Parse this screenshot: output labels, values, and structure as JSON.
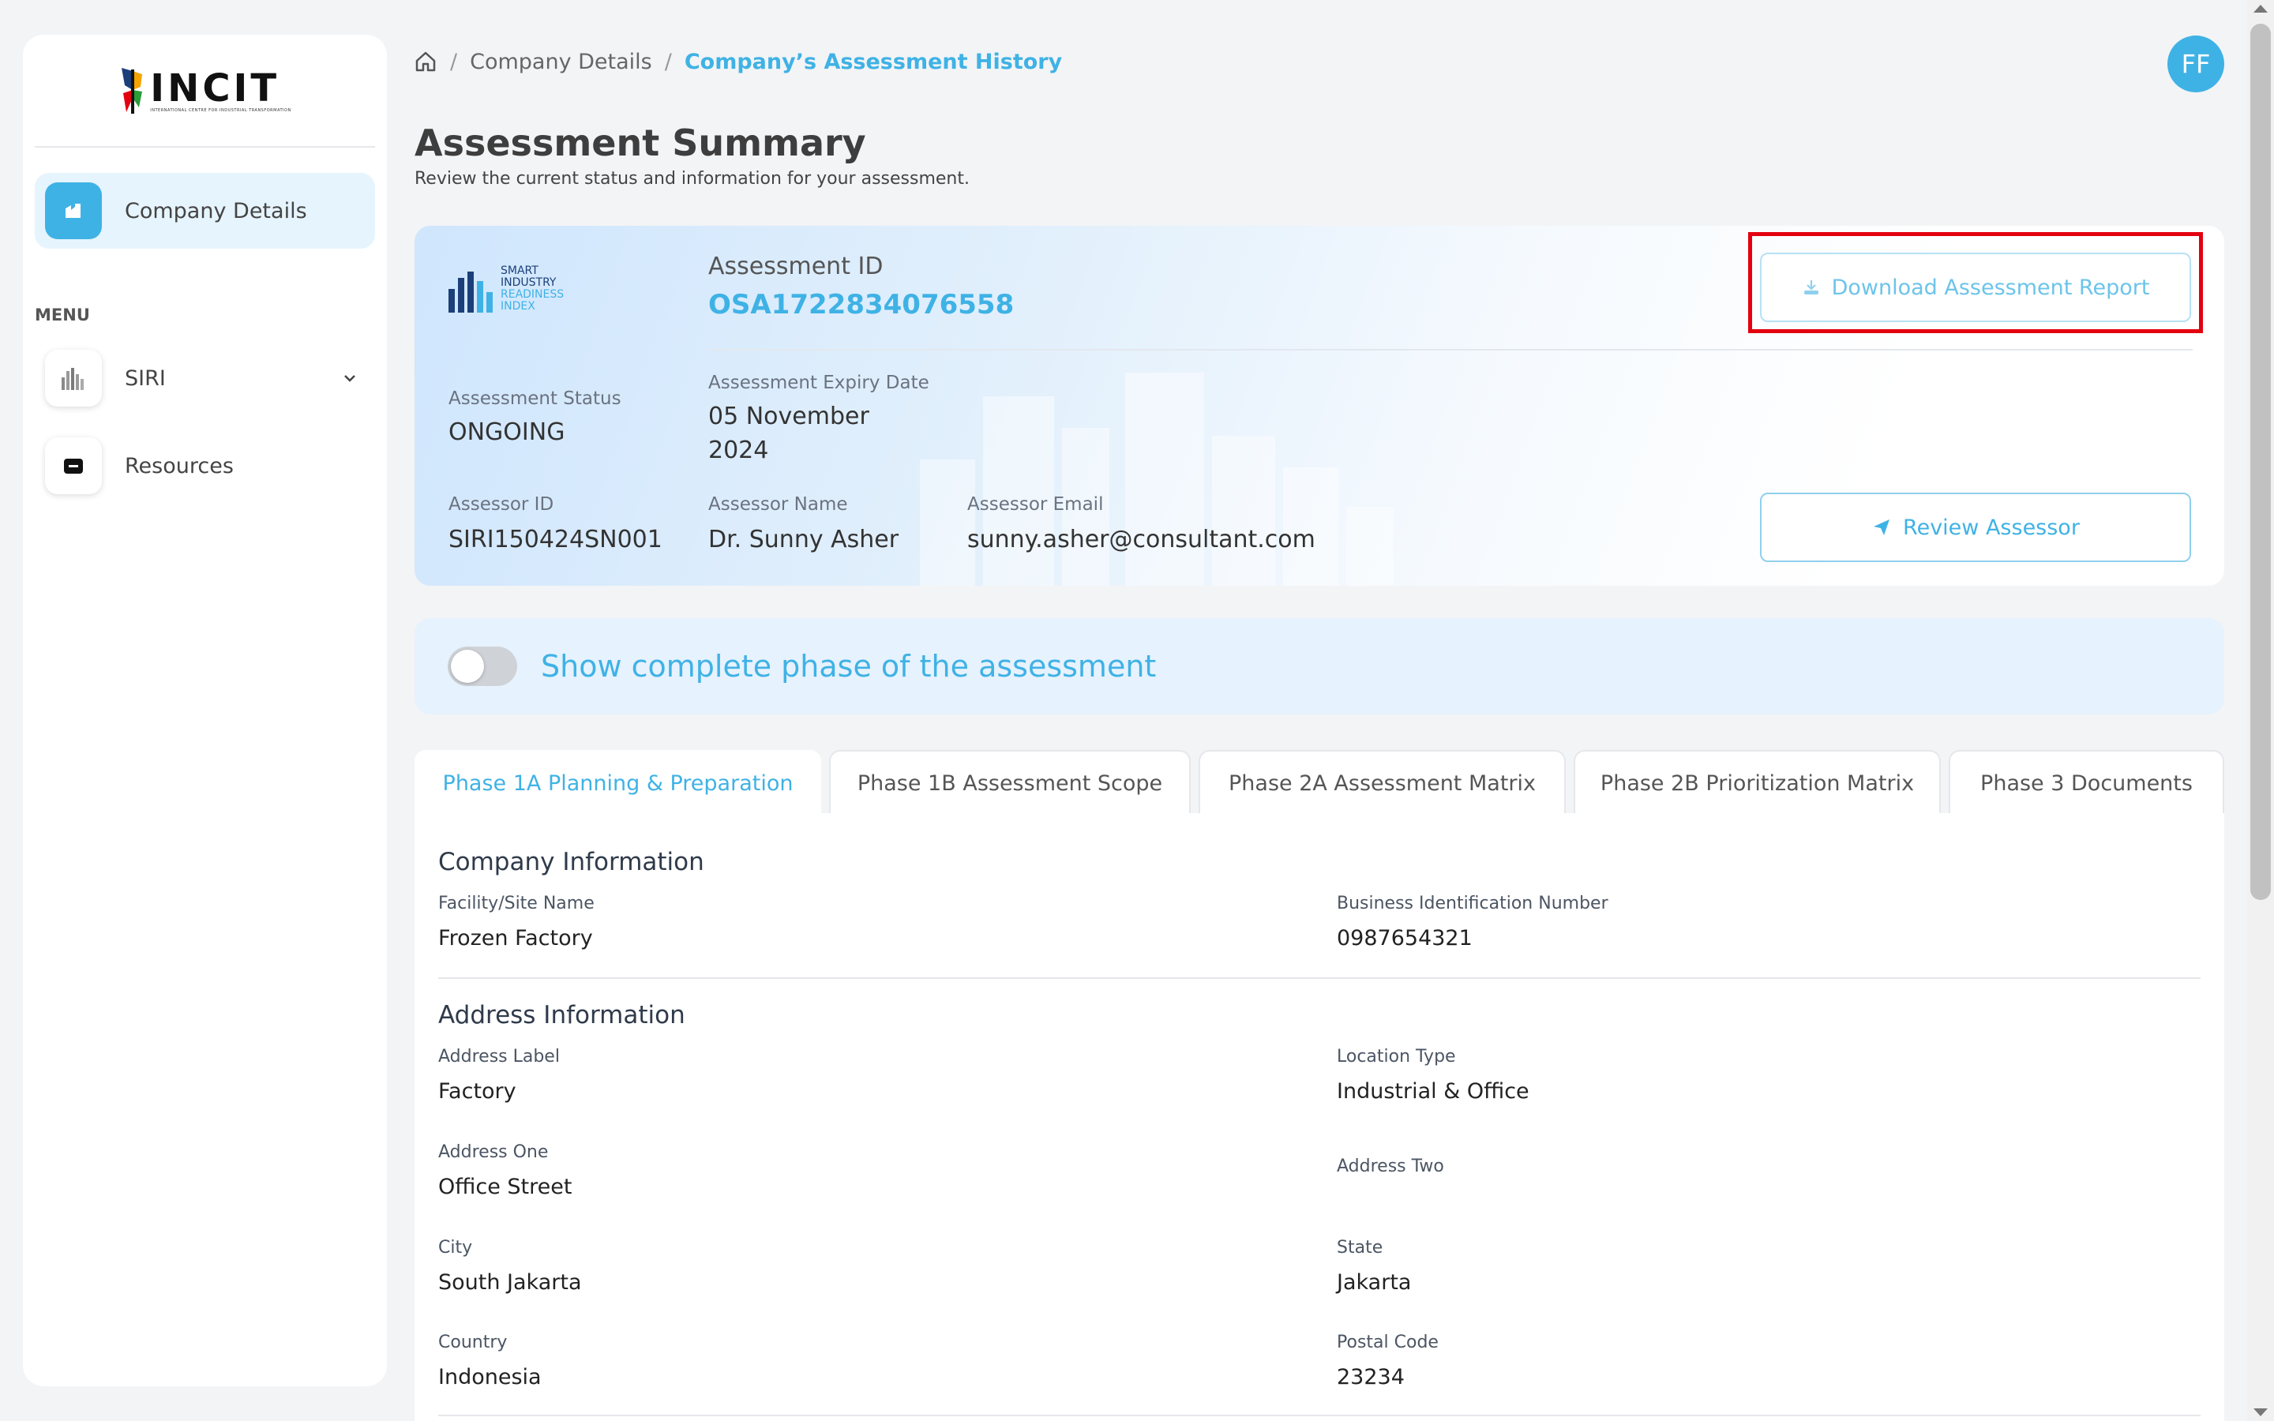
{
  "sidebar": {
    "logo_text": "INCIT",
    "logo_subtext": "INTERNATIONAL CENTRE FOR INDUSTRIAL TRANSFORMATION",
    "active_item": "Company Details",
    "menu_title": "MENU",
    "items": [
      {
        "label": "SIRI",
        "icon": "bar-chart-icon"
      },
      {
        "label": "Resources",
        "icon": "folder-icon"
      }
    ]
  },
  "breadcrumb": {
    "items": [
      "Company Details",
      "Company’s Assessment History"
    ]
  },
  "user": {
    "initials": "FF"
  },
  "page": {
    "title": "Assessment Summary",
    "subtitle": "Review the current status and information for your assessment."
  },
  "summary": {
    "siri_logo": [
      "SMART",
      "INDUSTRY",
      "READINESS",
      "INDEX"
    ],
    "assessment_id_label": "Assessment ID",
    "assessment_id": "OSA1722834076558",
    "download_label": "Download Assessment Report",
    "status_label": "Assessment Status",
    "status": "ONGOING",
    "expiry_label": "Assessment Expiry Date",
    "expiry_line1": "05 November",
    "expiry_line2": "2024",
    "assessor_id_label": "Assessor ID",
    "assessor_id": "SIRI150424SN001",
    "assessor_name_label": "Assessor Name",
    "assessor_name": "Dr. Sunny Asher",
    "assessor_email_label": "Assessor Email",
    "assessor_email": "sunny.asher@consultant.com",
    "review_label": "Review Assessor"
  },
  "toggle": {
    "label": "Show complete phase of the assessment",
    "on": false
  },
  "tabs": [
    "Phase 1A Planning & Preparation",
    "Phase 1B Assessment Scope",
    "Phase 2A Assessment Matrix",
    "Phase 2B Prioritization Matrix",
    "Phase 3 Documents"
  ],
  "company_info": {
    "title": "Company Information",
    "facility_label": "Facility/Site Name",
    "facility": "Frozen Factory",
    "bin_label": "Business Identification Number",
    "bin": "0987654321"
  },
  "address_info": {
    "title": "Address Information",
    "label_label": "Address Label",
    "label": "Factory",
    "location_type_label": "Location Type",
    "location_type": "Industrial & Office",
    "address_one_label": "Address One",
    "address_one": "Office Street",
    "address_two_label": "Address Two",
    "address_two": "",
    "city_label": "City",
    "city": "South Jakarta",
    "state_label": "State",
    "state": "Jakarta",
    "country_label": "Country",
    "country": "Indonesia",
    "postal_label": "Postal Code",
    "postal": "23234"
  },
  "colors": {
    "accent": "#3fb2e5",
    "highlight": "#e3000f",
    "navy": "#1c3f7a"
  }
}
